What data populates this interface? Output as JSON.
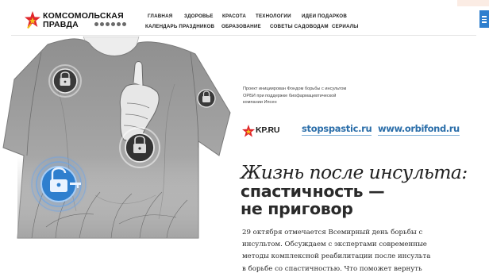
{
  "header": {
    "logo": {
      "line1": "КОМСОМОЛЬСКАЯ",
      "line2": "ПРАВДА"
    },
    "nav_row1": [
      "ГЛАВНАЯ",
      "ЗДОРОВЬЕ",
      "КРАСОТА",
      "ТЕХНОЛОГИИ",
      "ИДЕИ ПОДАРКОВ"
    ],
    "nav_row2": [
      "КАЛЕНДАРЬ ПРАЗДНИКОВ",
      "ОБРАЗОВАНИЕ",
      "СОВЕТЫ САДОВОДАМ",
      "СЕРИАЛЫ"
    ],
    "menu_icon": "hamburger-icon"
  },
  "hero": {
    "icons": [
      "padlock-icon",
      "padlock-icon",
      "padlock-icon",
      "key-unlock-icon"
    ]
  },
  "sponsor": {
    "text": "Проект инициирован Фондом борьбы с инсультом\nОРБИ при поддержке биофармацевтической\nкомпании Ипсен"
  },
  "partners": {
    "kp_logo": "KP.RU",
    "link1": "stopspastic.ru",
    "link2": "www.orbifond.ru"
  },
  "article": {
    "title_italic": "Жизнь после инсульта:",
    "title_bold_1": "спастичность —",
    "title_bold_2": "не приговор",
    "lede": "29 октября отмечается Всемирный день борьбы с\nинсультом. Обсуждаем с экспертами современные\nметоды комплексной реабилитации после инсульта\nв борьбе со спастичностью. Что поможет вернуть"
  },
  "colors": {
    "accent_blue": "#2f7fce",
    "link_blue": "#2b6ea9",
    "kp_red": "#e0262b",
    "kp_yellow": "#f3c21b"
  }
}
